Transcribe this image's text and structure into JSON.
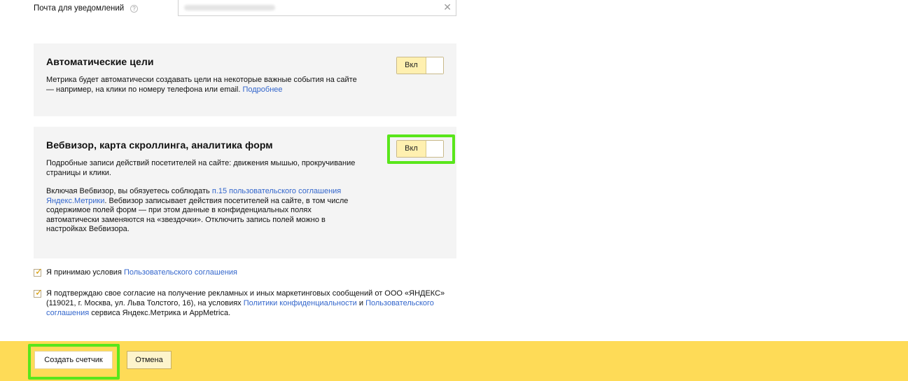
{
  "email": {
    "label": "Почта для уведомлений",
    "help_glyph": "?",
    "clear_glyph": "✕"
  },
  "auto_goals": {
    "title": "Автоматические цели",
    "description": "Метрика будет автоматически создавать цели на некоторые важные события на сайте — например, на клики по номеру телефона или email.",
    "more_link": "Подробнее",
    "toggle_label": "Вкл"
  },
  "webvisor": {
    "title": "Вебвизор, карта скроллинга, аналитика форм",
    "description": "Подробные записи действий посетителей на сайте: движения мышью, прокручивание страницы и клики.",
    "notice_prefix": "Включая Вебвизор, вы обязуетесь соблюдать",
    "notice_link": "п.15 пользовательского соглашения Яндекс.Метрики",
    "notice_suffix": ". Вебвизор записывает действия посетителей на сайте, в том числе содержимое полей форм — при этом данные в конфиденциальных полях автоматически заменяются на «звездочки». Отключить запись полей можно в настройках Вебвизора.",
    "toggle_label": "Вкл"
  },
  "agreements": {
    "terms_prefix": "Я принимаю условия",
    "terms_link": "Пользовательского соглашения",
    "marketing_prefix": "Я подтверждаю свое согласие на получение рекламных и иных маркетинговых сообщений от ООО «ЯНДЕКС» (119021, г. Москва, ул. Льва Толстого, 16), на условиях",
    "privacy_link": "Политики конфиденциальности",
    "marketing_and": "и",
    "user_agreement_link": "Пользовательского соглашения",
    "marketing_suffix": "сервиса Яндекс.Метрика и AppMetrica.",
    "check_glyph": "✓"
  },
  "footer": {
    "create_button": "Создать счетчик",
    "cancel_button": "Отмена"
  },
  "colors": {
    "footer_bg": "#fedb57",
    "highlight": "#59e61b",
    "link": "#3366cc",
    "panel_bg": "#f4f4f4"
  }
}
